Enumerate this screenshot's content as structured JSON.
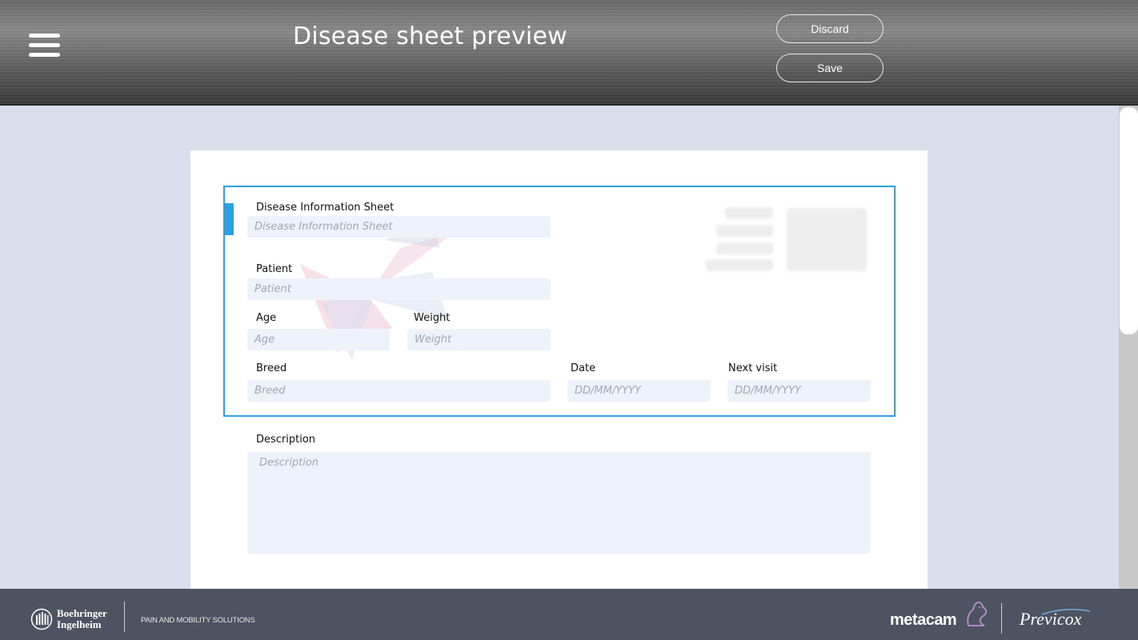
{
  "header": {
    "title": "Disease sheet preview",
    "discard_label": "Discard",
    "save_label": "Save"
  },
  "form": {
    "sheet_title": {
      "label": "Disease Information Sheet",
      "placeholder": "Disease Information Sheet"
    },
    "patient": {
      "label": "Patient",
      "placeholder": "Patient"
    },
    "age": {
      "label": "Age",
      "placeholder": "Age"
    },
    "weight": {
      "label": "Weight",
      "placeholder": "Weight"
    },
    "breed": {
      "label": "Breed",
      "placeholder": "Breed"
    },
    "date": {
      "label": "Date",
      "placeholder": "DD/MM/YYYY"
    },
    "next_visit": {
      "label": "Next visit",
      "placeholder": "DD/MM/YYYY"
    },
    "description": {
      "label": "Description",
      "placeholder": "Description"
    }
  },
  "footer": {
    "company_line1": "Boehringer",
    "company_line2": "Ingelheim",
    "tagline": "PAIN AND MOBILITY SOLUTIONS",
    "brand1": "metacam",
    "brand2": "Previcox"
  },
  "colors": {
    "accent": "#2ea0de",
    "footer_bg": "#4d5361",
    "page_bg": "#d9deec",
    "field_bg": "#edf2fb"
  }
}
